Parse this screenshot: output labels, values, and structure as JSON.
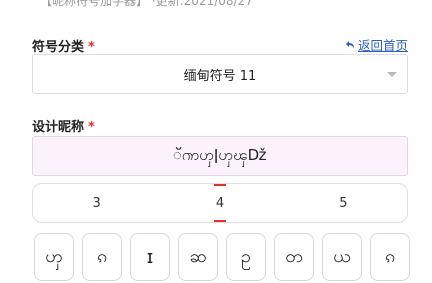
{
  "header": {
    "top_text": "【昵称符号加字器】 ·更新:2021/08/27"
  },
  "symbol_category": {
    "label": "符号分类",
    "required_mark": "*",
    "selected": "缅甸符号 11"
  },
  "back_link": {
    "label": "返回首页"
  },
  "nickname": {
    "label": "设计昵称",
    "required_mark": "*",
    "value": "ॅ‍ၮ‍ၯ‍ǀ‍ၯ‍ၾǅ"
  },
  "pager": {
    "pages": [
      "3",
      "4",
      "5"
    ],
    "active_index": 1
  },
  "keys": [
    "ၯ",
    "ၵ",
    "ɪ",
    "ဆ",
    "ဥ",
    "တ",
    "ယ",
    "ၵ"
  ]
}
